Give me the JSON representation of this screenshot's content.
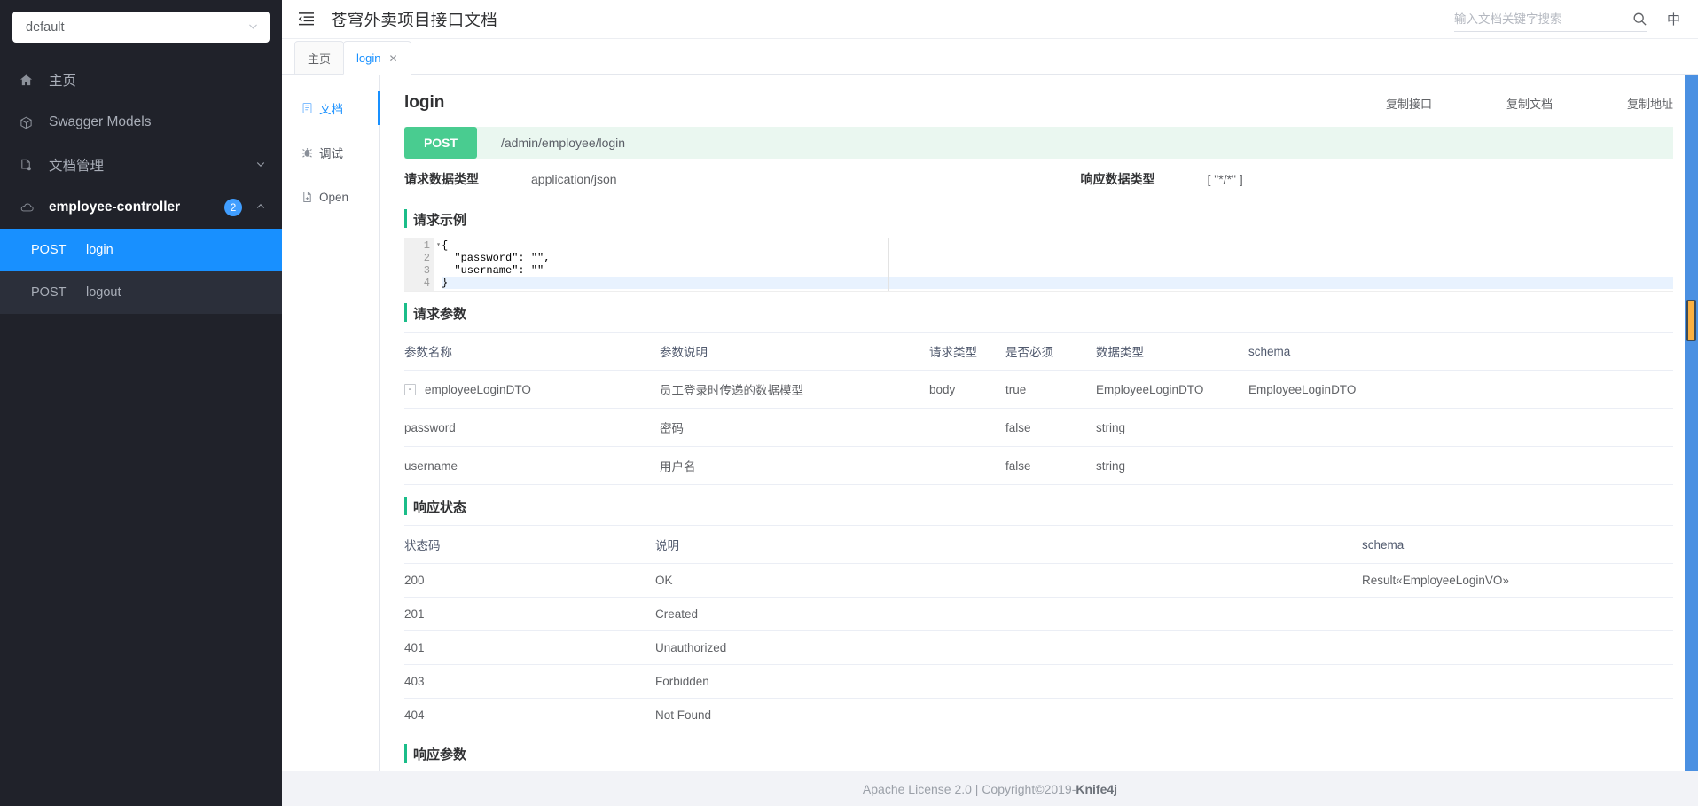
{
  "sidebar": {
    "select_value": "default",
    "caret_icon": "chevron-down-icon",
    "items": [
      {
        "label": "主页",
        "icon": "home-icon"
      },
      {
        "label": "Swagger Models",
        "icon": "cube-icon"
      },
      {
        "label": "文档管理",
        "icon": "document-settings-icon",
        "chevron": "chevron-down-icon"
      },
      {
        "label": "employee-controller",
        "icon": "cloud-icon",
        "badge": "2",
        "chevron": "chevron-up-icon"
      }
    ],
    "apis": [
      {
        "method": "POST",
        "name": "login",
        "selected": true
      },
      {
        "method": "POST",
        "name": "logout",
        "selected": false
      }
    ]
  },
  "topbar": {
    "collapse_icon": "menu-fold-icon",
    "title": "苍穹外卖项目接口文档",
    "search_placeholder": "输入文档关键字搜索",
    "search_value": "",
    "search_icon": "search-icon",
    "lang_label": "中"
  },
  "tabs": [
    {
      "label": "主页",
      "active": false,
      "closable": false
    },
    {
      "label": "login",
      "active": true,
      "closable": true,
      "close_label": "✕"
    }
  ],
  "vtabs": [
    {
      "label": "文档",
      "icon": "doc-icon",
      "active": true
    },
    {
      "label": "调试",
      "icon": "bug-icon",
      "active": false
    },
    {
      "label": "Open",
      "icon": "file-icon",
      "active": false
    }
  ],
  "doc": {
    "title": "login",
    "copy_buttons": [
      "复制接口",
      "复制文档",
      "复制地址"
    ],
    "method": "POST",
    "url": "/admin/employee/login",
    "request_type_label": "请求数据类型",
    "request_type_value": "application/json",
    "response_type_label": "响应数据类型",
    "response_type_value": "[ \"*/*\" ]",
    "request_example_title": "请求示例",
    "code_lines": [
      {
        "no": "1",
        "fold": "▾",
        "text": "{"
      },
      {
        "no": "2",
        "fold": "",
        "text": "  \"password\": \"\","
      },
      {
        "no": "3",
        "fold": "",
        "text": "  \"username\": \"\""
      },
      {
        "no": "4",
        "fold": "",
        "text": "}"
      }
    ],
    "request_params_title": "请求参数",
    "request_params_headers": [
      "参数名称",
      "参数说明",
      "请求类型",
      "是否必须",
      "数据类型",
      "schema"
    ],
    "request_params_rows": [
      {
        "name": "employeeLoginDTO",
        "expandable": true,
        "expander": "-",
        "indent": 0,
        "desc": "员工登录时传递的数据模型",
        "req_type": "body",
        "required": "true",
        "required_red": true,
        "data_type": "EmployeeLoginDTO",
        "schema": "EmployeeLoginDTO"
      },
      {
        "name": "password",
        "expandable": false,
        "expander": "",
        "indent": 1,
        "desc": "密码",
        "req_type": "",
        "required": "false",
        "required_red": false,
        "data_type": "string",
        "schema": ""
      },
      {
        "name": "username",
        "expandable": false,
        "expander": "",
        "indent": 1,
        "desc": "用户名",
        "req_type": "",
        "required": "false",
        "required_red": false,
        "data_type": "string",
        "schema": ""
      }
    ],
    "response_status_title": "响应状态",
    "response_status_headers": [
      "状态码",
      "说明",
      "schema"
    ],
    "response_status_rows": [
      {
        "code": "200",
        "desc": "OK",
        "schema": "Result«EmployeeLoginVO»"
      },
      {
        "code": "201",
        "desc": "Created",
        "schema": ""
      },
      {
        "code": "401",
        "desc": "Unauthorized",
        "schema": ""
      },
      {
        "code": "403",
        "desc": "Forbidden",
        "schema": ""
      },
      {
        "code": "404",
        "desc": "Not Found",
        "schema": ""
      }
    ],
    "response_params_title": "响应参数"
  },
  "footer": {
    "license": "Apache License 2.0 | Copyright ",
    "copyright_symbol": "©",
    "year_brand": " 2019-",
    "brand": "Knife4j"
  },
  "colors": {
    "sidebar_bg": "#20222a",
    "accent_blue": "#1890ff",
    "method_green": "#49cc90",
    "section_bar": "#1bbd89",
    "required_red": "#ff4d4f",
    "scrollbar_track": "#4a90e2",
    "scrollbar_thumb": "#fbb040"
  }
}
